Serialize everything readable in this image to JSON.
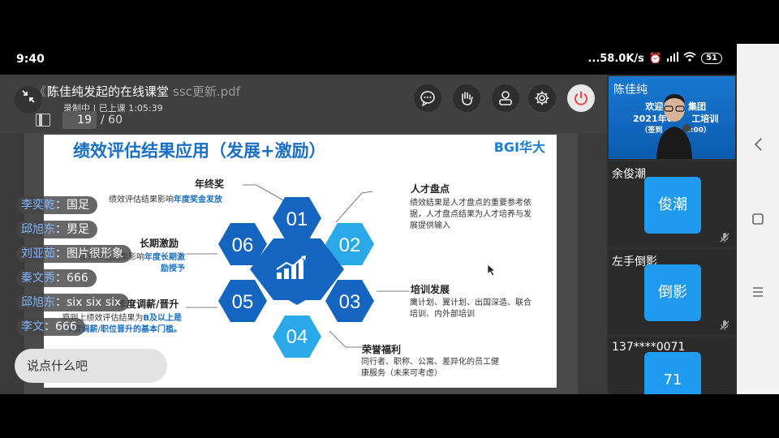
{
  "status": {
    "time": "9:40",
    "net_speed": "...58.0K/s",
    "battery": "51"
  },
  "header": {
    "class_title": "陈佳纯发起的在线课堂",
    "file_name_prefix": "《1",
    "file_name_suffix": "ssc更新.pdf",
    "rec_status": "录制中 | 已上课 1:05:39",
    "page_current": "19",
    "page_total": "/ 60"
  },
  "toolbar": {
    "icons": [
      "chat-icon",
      "raise-hand-icon",
      "user-icon",
      "gear-icon",
      "power-icon"
    ]
  },
  "slide": {
    "title": "绩效评估结果应用（发展+激励）",
    "logo": "BGI华大",
    "hex_numbers": [
      "01",
      "02",
      "03",
      "04",
      "05",
      "06"
    ],
    "blocks": {
      "annual_bonus": {
        "head": "年终奖",
        "text": "绩效评估结果影响",
        "text_bold": "年度奖金发放"
      },
      "talent_review": {
        "head": "人才盘点",
        "text": "绩效结果是人才盘点的重要参考依据，人才盘点结果为人才培养与发展提供输入"
      },
      "long_term": {
        "head": "长期激励",
        "text": "绩效评估结果影响",
        "text_bold": "年度长期激励授予"
      },
      "training": {
        "head": "培训发展",
        "text": "鹰计划、翼计划、出国深造、联合培训、内外部培训"
      },
      "salary": {
        "head": "年度调薪/晋升",
        "text": "原则上绩效评估结果为",
        "text_bold": "B及以上是年度调薪/职位晋升的基本门槛。"
      },
      "honor": {
        "head": "荣誉福利",
        "text": "同行者、职称、公寓、差异化的员工健康服务（未来可考虑）"
      }
    }
  },
  "chat": {
    "messages": [
      {
        "who": "李奕乾",
        "msg": "国足"
      },
      {
        "who": "邱旭东",
        "msg": "男足"
      },
      {
        "who": "刘亚茹",
        "msg": "图片很形象"
      },
      {
        "who": "秦文秀",
        "msg": "666"
      },
      {
        "who": "邱旭东",
        "msg": "six six six"
      },
      {
        "who": "李文",
        "msg": "666"
      }
    ],
    "input_placeholder": "说点什么吧"
  },
  "participants": [
    {
      "name": "陈佳纯",
      "banner_l1": "欢迎",
      "banner_l1b": "集团",
      "banner_l2": "2021年0",
      "banner_l2b": "工培训",
      "banner_l3": "（签到",
      "banner_l3b": "0:00）"
    },
    {
      "name": "余俊潮",
      "avatar": "俊潮"
    },
    {
      "name": "左手倒影",
      "avatar": "倒影"
    },
    {
      "name": "137****0071",
      "avatar": "71"
    }
  ],
  "colors": {
    "accent_blue": "#1a6fc4",
    "hex_dark": "#1565c0",
    "hex_light": "#29a8ea",
    "avatar_blue": "#1e9bf0"
  }
}
